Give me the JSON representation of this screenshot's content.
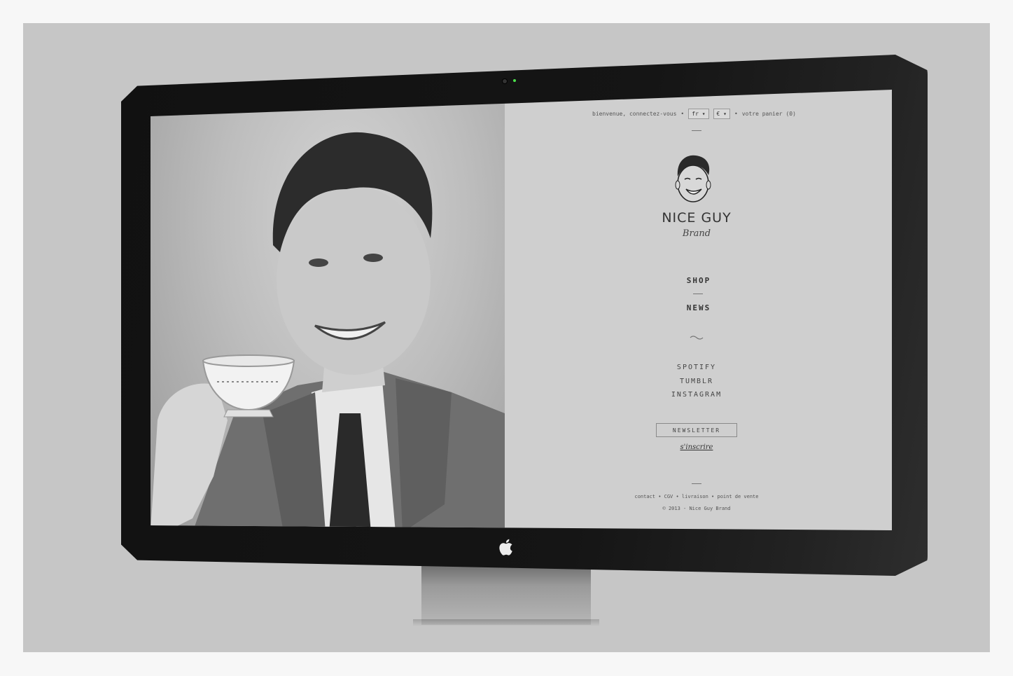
{
  "header": {
    "welcome_text": "bienvenue, connectez-vous",
    "language": "fr",
    "currency": "€",
    "cart_text": "votre panier (0)",
    "separator": "•"
  },
  "brand": {
    "name": "NICE GUY",
    "subtitle": "Brand"
  },
  "nav": {
    "items": [
      "SHOP",
      "NEWS"
    ]
  },
  "social": {
    "items": [
      "SPOTIFY",
      "TUMBLR",
      "INSTAGRAM"
    ]
  },
  "newsletter": {
    "label": "NEWSLETTER",
    "subscribe": "s'inscrire"
  },
  "footer": {
    "links": "contact • CGV • livraison • point de vente",
    "copyright": "© 2013 - Nice Guy Brand"
  },
  "colors": {
    "site_background": "#cfcfcf",
    "bezel": "#141414",
    "camera_led": "#4be04b"
  }
}
